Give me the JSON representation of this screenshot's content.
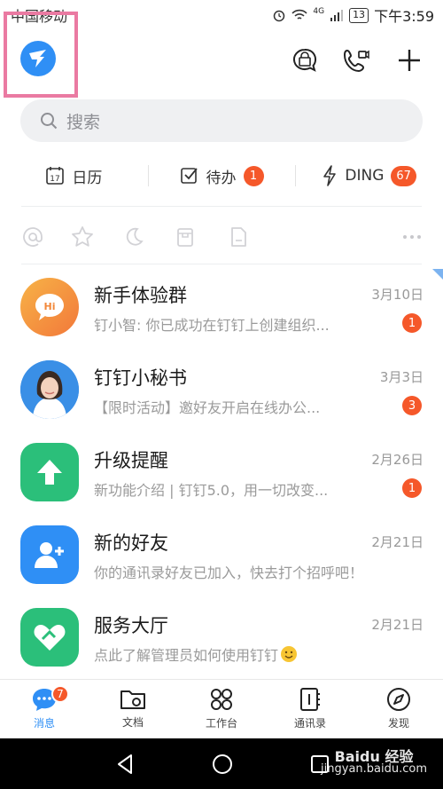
{
  "status_bar": {
    "carrier": "中国移动",
    "network": "4G",
    "battery": "13",
    "time": "下午3:59"
  },
  "search": {
    "placeholder": "搜索"
  },
  "quick_row": [
    {
      "label": "日历",
      "icon": "calendar-icon",
      "badge": ""
    },
    {
      "label": "待办",
      "icon": "checkbox-icon",
      "badge": "1"
    },
    {
      "label": "DING",
      "icon": "lightning-icon",
      "badge": "67"
    }
  ],
  "chats": [
    {
      "name": "新手体验群",
      "date": "3月10日",
      "preview": "钉小智: 你已成功在钉钉上创建组织...",
      "unread": "1",
      "avatar_text": "Hi",
      "avatar_color": "#f5a24a"
    },
    {
      "name": "钉钉小秘书",
      "date": "3月3日",
      "preview": "【限时活动】邀好友开启在线办公...",
      "unread": "3",
      "avatar_color": "#2f8ff5"
    },
    {
      "name": "升级提醒",
      "date": "2月26日",
      "preview": "新功能介绍 | 钉钉5.0，用一切改变...",
      "unread": "1",
      "avatar_color": "#2bbf7a"
    },
    {
      "name": "新的好友",
      "date": "2月21日",
      "preview": "你的通讯录好友已加入，快去打个招呼吧！",
      "unread": "",
      "avatar_color": "#2f8ff5"
    },
    {
      "name": "服务大厅",
      "date": "2月21日",
      "preview": "点此了解管理员如何使用钉钉",
      "unread": "",
      "avatar_color": "#2bbf7a"
    }
  ],
  "tabs": [
    {
      "label": "消息",
      "icon": "message-icon",
      "badge": "7",
      "active": true
    },
    {
      "label": "文档",
      "icon": "folder-icon",
      "badge": "",
      "active": false
    },
    {
      "label": "工作台",
      "icon": "grid-icon",
      "badge": "",
      "active": false
    },
    {
      "label": "通讯录",
      "icon": "contacts-icon",
      "badge": "",
      "active": false
    },
    {
      "label": "发现",
      "icon": "compass-icon",
      "badge": "",
      "active": false
    }
  ],
  "watermark": {
    "brand": "Baidu 经验",
    "url": "jingyan.baidu.com"
  },
  "colors": {
    "accent": "#2f8ff5",
    "badge": "#f5582a",
    "highlight": "#ea7aa2"
  }
}
